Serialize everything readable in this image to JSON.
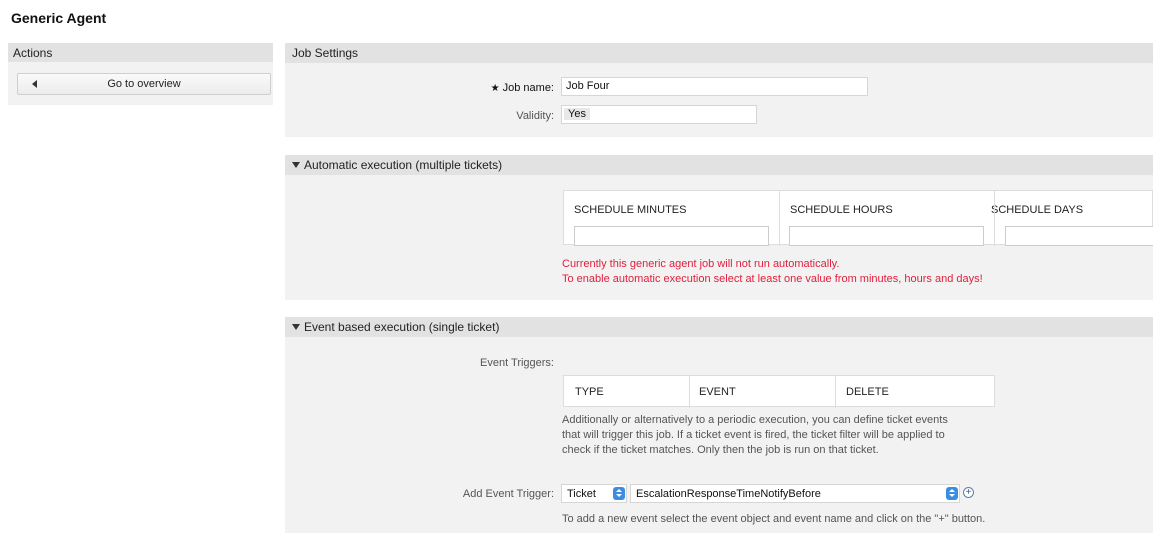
{
  "page": {
    "title": "Generic Agent"
  },
  "sidebar": {
    "header": "Actions",
    "overview_button": "Go to overview"
  },
  "job_settings": {
    "header": "Job Settings",
    "job_name_label": "Job name:",
    "job_name_value": "Job Four",
    "validity_label": "Validity:",
    "validity_value": "Yes"
  },
  "automatic": {
    "header": "Automatic execution (multiple tickets)",
    "columns": [
      "SCHEDULE MINUTES",
      "SCHEDULE HOURS",
      "SCHEDULE DAYS"
    ],
    "warning_line1": "Currently this generic agent job will not run automatically.",
    "warning_line2": "To enable automatic execution select at least one value from minutes, hours and days!"
  },
  "event_based": {
    "header": "Event based execution (single ticket)",
    "triggers_label": "Event Triggers:",
    "columns": [
      "TYPE",
      "EVENT",
      "DELETE"
    ],
    "help_lines": [
      "Additionally or alternatively to a periodic execution, you can define ticket events",
      "that will trigger this job. If a ticket event is fired, the ticket filter will be applied to",
      "check if the ticket matches. Only then the job is run on that ticket."
    ],
    "add_trigger_label": "Add Event Trigger:",
    "object_value": "Ticket",
    "event_value": "EscalationResponseTimeNotifyBefore",
    "add_help": "To add a new event select the event object and event name and click on the \"+\" button."
  },
  "colors": {
    "warning": "#e0203f",
    "select_arrow": "#3b8de0"
  }
}
